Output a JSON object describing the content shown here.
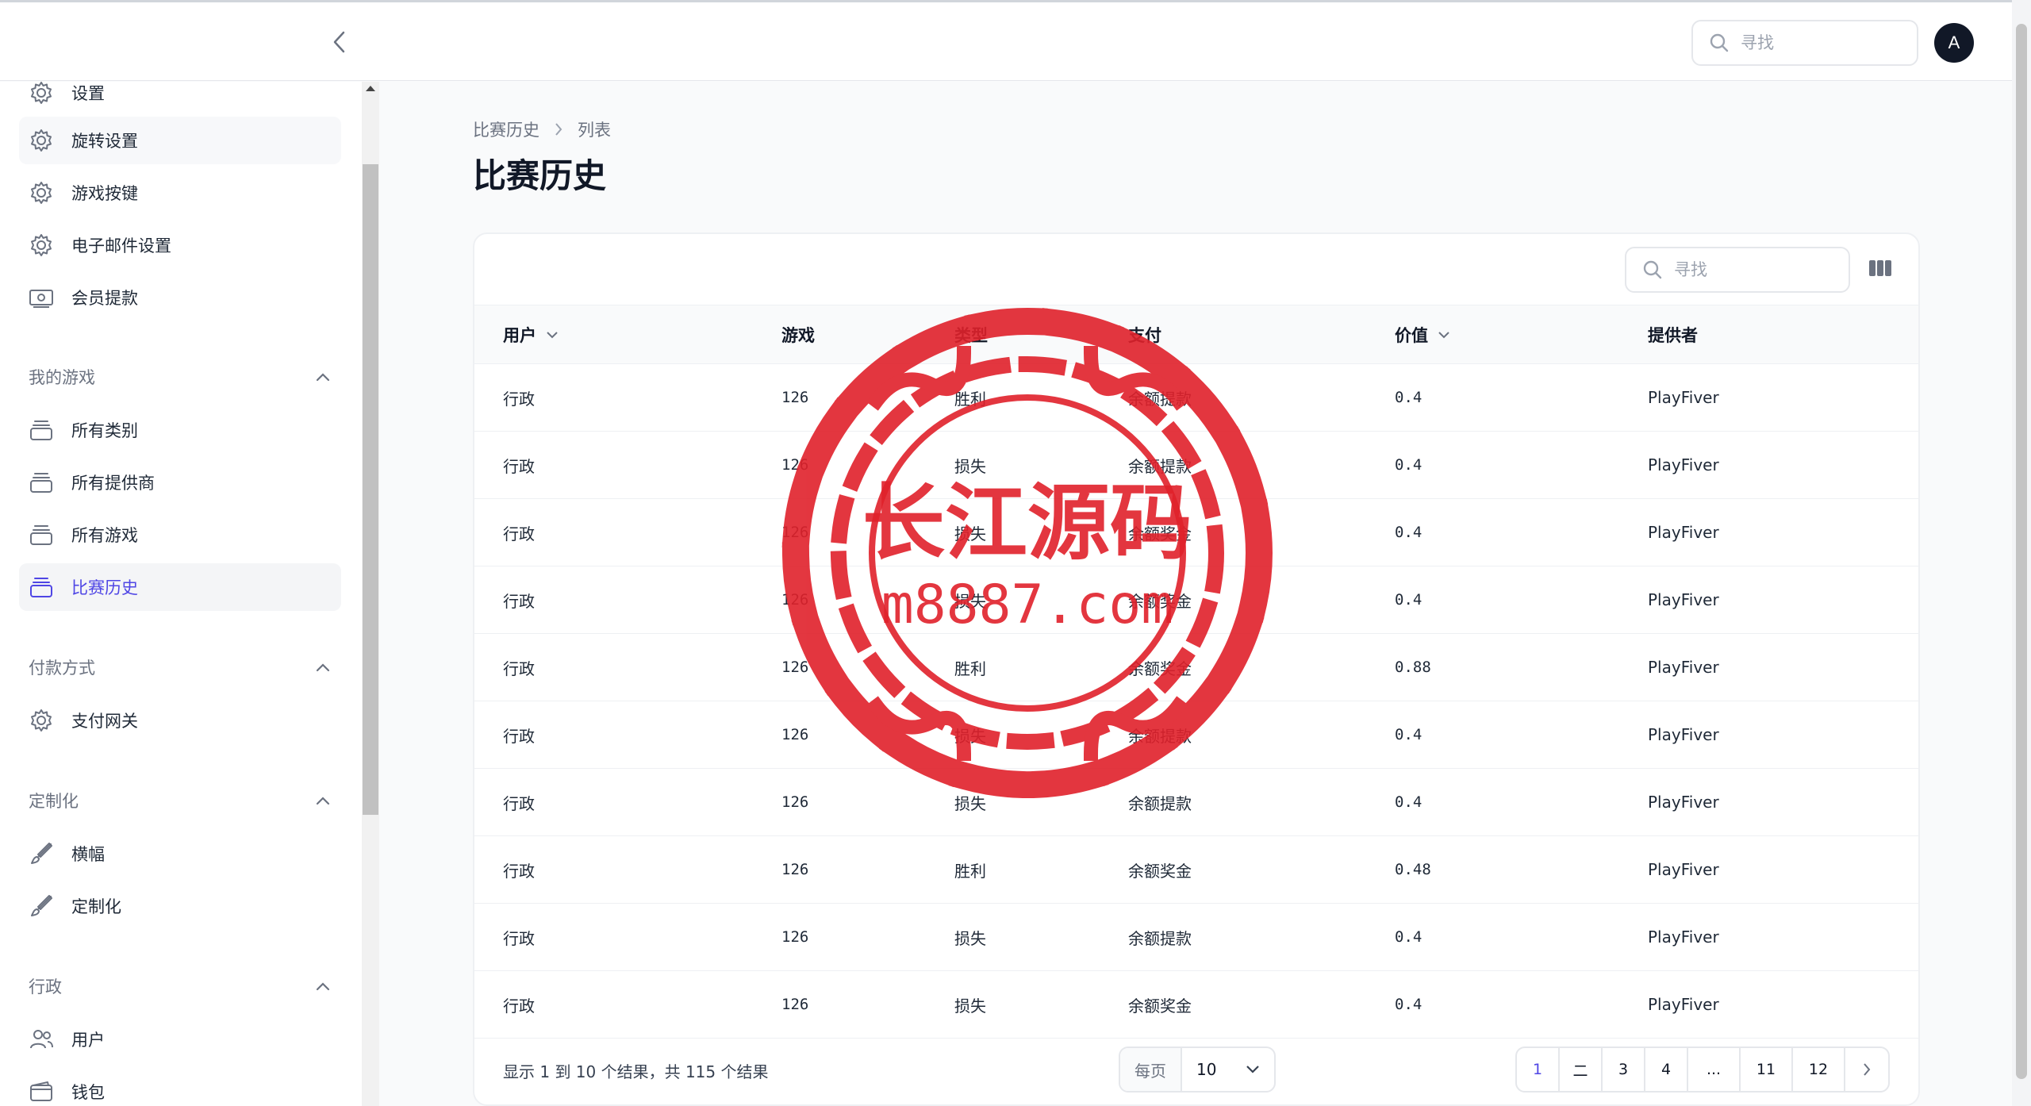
{
  "topbar": {
    "search_placeholder": "寻找",
    "avatar_initial": "A"
  },
  "sidebar": {
    "items_top": [
      {
        "label": "设置",
        "icon": "gear-icon"
      },
      {
        "label": "旋转设置",
        "icon": "gear-icon"
      },
      {
        "label": "游戏按键",
        "icon": "gear-icon"
      },
      {
        "label": "电子邮件设置",
        "icon": "gear-icon"
      },
      {
        "label": "会员提款",
        "icon": "cash-icon"
      }
    ],
    "groups": [
      {
        "label": "我的游戏",
        "items": [
          {
            "label": "所有类别",
            "icon": "stack-icon"
          },
          {
            "label": "所有提供商",
            "icon": "stack-icon"
          },
          {
            "label": "所有游戏",
            "icon": "stack-icon"
          },
          {
            "label": "比赛历史",
            "icon": "stack-icon"
          }
        ]
      },
      {
        "label": "付款方式",
        "items": [
          {
            "label": "支付网关",
            "icon": "gear-icon"
          }
        ]
      },
      {
        "label": "定制化",
        "items": [
          {
            "label": "横幅",
            "icon": "brush-icon"
          },
          {
            "label": "定制化",
            "icon": "brush-icon"
          }
        ]
      },
      {
        "label": "行政",
        "items": [
          {
            "label": "用户",
            "icon": "users-icon"
          },
          {
            "label": "钱包",
            "icon": "wallet-icon"
          }
        ]
      }
    ]
  },
  "breadcrumb": {
    "parent": "比赛历史",
    "current": "列表"
  },
  "page_title": "比赛历史",
  "table": {
    "search_placeholder": "寻找",
    "columns": [
      "用户",
      "游戏",
      "类型",
      "支付",
      "价值",
      "提供者"
    ],
    "rows": [
      [
        "行政",
        "126",
        "胜利",
        "余额提款",
        "0.4",
        "PlayFiver"
      ],
      [
        "行政",
        "126",
        "损失",
        "余额提款",
        "0.4",
        "PlayFiver"
      ],
      [
        "行政",
        "126",
        "损失",
        "余额奖金",
        "0.4",
        "PlayFiver"
      ],
      [
        "行政",
        "126",
        "损失",
        "余额奖金",
        "0.4",
        "PlayFiver"
      ],
      [
        "行政",
        "126",
        "胜利",
        "余额奖金",
        "0.88",
        "PlayFiver"
      ],
      [
        "行政",
        "126",
        "损失",
        "余额提款",
        "0.4",
        "PlayFiver"
      ],
      [
        "行政",
        "126",
        "损失",
        "余额提款",
        "0.4",
        "PlayFiver"
      ],
      [
        "行政",
        "126",
        "胜利",
        "余额奖金",
        "0.48",
        "PlayFiver"
      ],
      [
        "行政",
        "126",
        "损失",
        "余额提款",
        "0.4",
        "PlayFiver"
      ],
      [
        "行政",
        "126",
        "损失",
        "余额奖金",
        "0.4",
        "PlayFiver"
      ]
    ],
    "result_text": "显示 1 到 10 个结果，共 115 个结果",
    "per_page_label": "每页",
    "per_page_value": "10",
    "pages": [
      "1",
      "二",
      "3",
      "4",
      "...",
      "11",
      "12"
    ]
  },
  "watermark": {
    "line1": "长江源码",
    "line2": "m8887.com"
  },
  "colors": {
    "accent": "#4f46e5",
    "watermark": "#e0212b"
  }
}
